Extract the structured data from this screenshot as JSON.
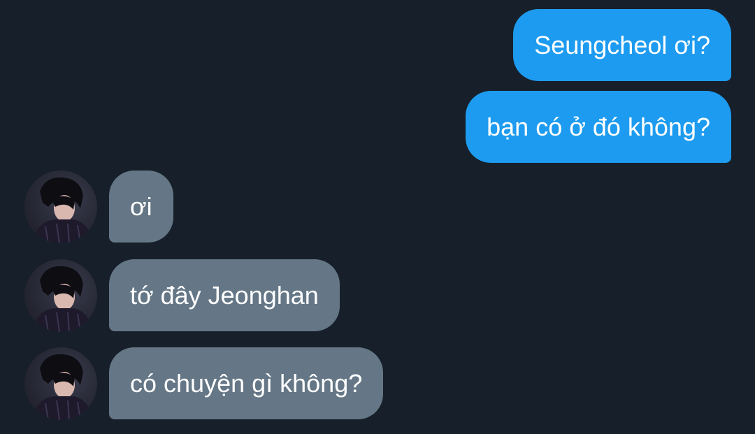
{
  "messages": [
    {
      "from": "me",
      "text": "Seungcheol ơi?"
    },
    {
      "from": "me",
      "text": "bạn có ở đó không?"
    },
    {
      "from": "other",
      "text": "ơi"
    },
    {
      "from": "other",
      "text": "tớ đây Jeonghan"
    },
    {
      "from": "other",
      "text": "có chuyện gì không?"
    }
  ],
  "colors": {
    "background": "#17202a",
    "sent_bubble": "#1d9bf0",
    "received_bubble": "#657786",
    "text": "#ffffff"
  },
  "icons": {
    "avatar": "contact-avatar-photo"
  }
}
